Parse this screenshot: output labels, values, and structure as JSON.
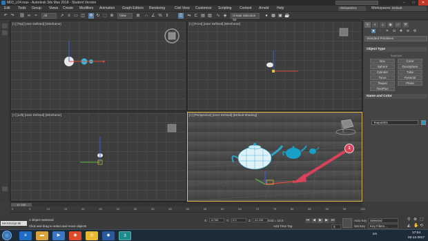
{
  "title_bar": {
    "title": "M03_L04.max - Autodesk 3ds Max 2018 - Student Version",
    "search_placeholder": ""
  },
  "menu": {
    "items": [
      "Edit",
      "Tools",
      "Group",
      "Views",
      "Create",
      "Modifiers",
      "Animation",
      "Graph Editors",
      "Rendering",
      "Civil View",
      "Customize",
      "Scripting",
      "Content",
      "Arnold",
      "Help"
    ],
    "account": "Aleksandrov",
    "workspaces_label": "Workspaces:",
    "workspace_value": "Default"
  },
  "toolbar": {
    "filter_value": "All",
    "refcoord_value": "View",
    "selection_set_value": "Create Selection Se"
  },
  "viewports": {
    "top": {
      "label": "[+] [Top] [User Defined] [Wireframe]"
    },
    "front": {
      "label": "[+] [Front] [User Defined] [Wireframe]"
    },
    "left": {
      "label": "[+] [Left] [User Defined] [Wireframe]"
    },
    "perspective": {
      "label": "[+] [Perspective] [User Defined] [Default Shading]"
    }
  },
  "annotation": {
    "number": "1"
  },
  "command_panel": {
    "category_dropdown": "Standard Primitives",
    "object_type_title": "Object Type",
    "autogrid_label": "AutoGrid",
    "objects": [
      "Box",
      "Cone",
      "Sphere",
      "GeoSphere",
      "Cylinder",
      "Tube",
      "Torus",
      "Pyramid",
      "Teapot",
      "Plane",
      "TextPlus"
    ],
    "name_color_title": "Name and Color",
    "name_value": "Teapot001",
    "object_color": "#19a0c8"
  },
  "timeline": {
    "slider_label": "0 / 100",
    "progress": 0.0,
    "ticks": [
      "0",
      "5",
      "10",
      "15",
      "20",
      "25",
      "30",
      "35",
      "40",
      "45",
      "50",
      "55",
      "60",
      "65",
      "70",
      "75",
      "80",
      "85",
      "90",
      "95",
      "100"
    ]
  },
  "status": {
    "maxscript_label": "MAXScript Mi",
    "selection_status": "1 Object Selected",
    "prompt": "Click and drag to select and move objects",
    "x_label": "X:",
    "x_value": "-6,784",
    "y_label": "Y:",
    "y_value": "0,0",
    "z_label": "Z:",
    "z_value": "-11,153",
    "grid_text": "Grid = 10,0",
    "add_time_tag": "Add Time Tag",
    "frame_value": "0",
    "autokey_label": "Auto Key",
    "autokey_value": "Selected",
    "setkey_label": "Set Key",
    "keyfilters_label": "Key Filters..."
  },
  "taskbar": {
    "tray_text": "EN",
    "time": "17:04",
    "date": "03.12.2017"
  },
  "colors": {
    "accent_blue": "#5a7fa8",
    "annotation_red": "#d9435a",
    "teapot_cyan": "#19a0c8",
    "active_viewport_border": "#e0b84a"
  }
}
